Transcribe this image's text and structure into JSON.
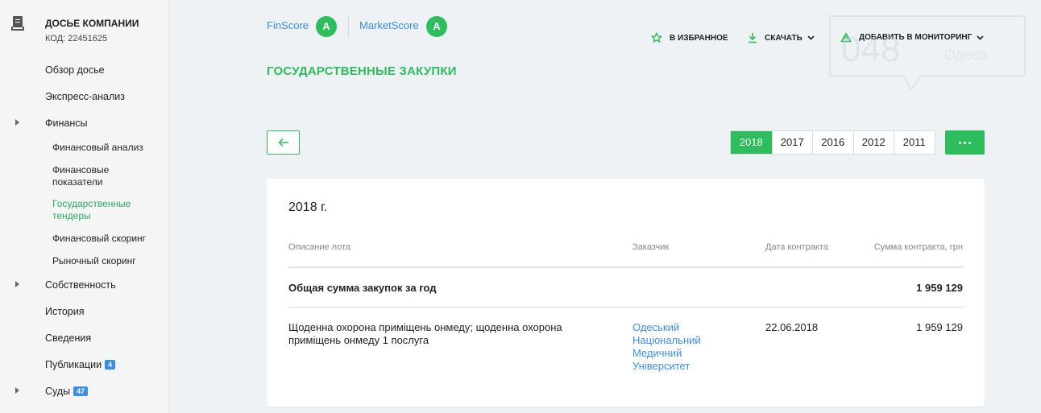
{
  "sidebar": {
    "title": "ДОСЬЕ КОМПАНИИ",
    "code": "КОД: 22451625",
    "items": [
      {
        "label": "Обзор досье"
      },
      {
        "label": "Экспресс-анализ"
      },
      {
        "label": "Финансы"
      },
      {
        "label": "Собственность"
      },
      {
        "label": "История"
      },
      {
        "label": "Сведения"
      },
      {
        "label": "Публикации",
        "badge": "4"
      },
      {
        "label": "Суды",
        "badge": "47"
      }
    ],
    "finance_sub": [
      {
        "label": "Финансовый анализ"
      },
      {
        "label": "Финансовые показатели"
      },
      {
        "label": "Государственные тендеры"
      },
      {
        "label": "Финансовый скоринг"
      },
      {
        "label": "Рыночный скоринг"
      }
    ]
  },
  "header": {
    "finscore_label": "FinScore",
    "finscore_grade": "A",
    "marketscore_label": "MarketScore",
    "marketscore_grade": "A",
    "favorite_label": "В ИЗБРАННОЕ",
    "download_label": "СКАЧАТЬ",
    "monitoring_label": "ДОБАВИТЬ В МОНИТОРИНГ",
    "watermark_text": "048",
    "watermark_sub": "Одеса"
  },
  "page_title": "ГОСУДАРСТВЕННЫЕ ЗАКУПКИ",
  "years": [
    "2018",
    "2017",
    "2016",
    "2012",
    "2011"
  ],
  "active_year": "2018",
  "card": {
    "year_title": "2018 г.",
    "columns": {
      "description": "Описание лота",
      "customer": "Заказчик",
      "date": "Дата контракта",
      "sum": "Сумма контракта, грн"
    },
    "total_label": "Общая сумма закупок за год",
    "total_value": "1 959 129",
    "rows": [
      {
        "description_line1": "Щоденна охорона приміщень онмеду; щоденна охорона",
        "description_line2": "приміщень онмеду 1 послуга",
        "customer_lines": [
          "Одеський",
          "Національний",
          "Медичний",
          "Університет"
        ],
        "date": "22.06.2018",
        "sum": "1 959 129"
      }
    ]
  },
  "colors": {
    "accent_green": "#2dbd5d",
    "link_blue": "#3a8ee6",
    "background": "#eef2f5"
  }
}
